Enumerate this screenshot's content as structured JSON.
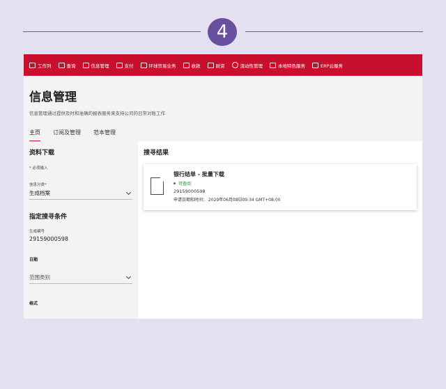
{
  "step": {
    "number": "4"
  },
  "nav": {
    "items": [
      {
        "icon": "briefcase-icon",
        "label": "工作列"
      },
      {
        "icon": "camera-icon",
        "label": "查询"
      },
      {
        "icon": "folder-icon",
        "label": "信息管理"
      },
      {
        "icon": "wallet-icon",
        "label": "支付"
      },
      {
        "icon": "globe-icon",
        "label": "环球贸易业务"
      },
      {
        "icon": "cash-icon",
        "label": "收款"
      },
      {
        "icon": "folder-icon",
        "label": "财资"
      },
      {
        "icon": "currency-icon",
        "label": "流动性管理"
      },
      {
        "icon": "bank-icon",
        "label": "本地特色服务"
      },
      {
        "icon": "document-icon",
        "label": "ERP云服务"
      }
    ]
  },
  "page": {
    "title": "信息管理",
    "subtitle": "信息管理通过提供及时和准确的报表服务来支持公司的日常对账工作"
  },
  "tabs": [
    {
      "label": "主页",
      "active": true
    },
    {
      "label": "订阅及管理",
      "active": false
    },
    {
      "label": "范本管理",
      "active": false
    }
  ],
  "left": {
    "download_title": "资料下载",
    "required_note": "* 必须输入",
    "category_label": "信息分类*",
    "category_value": "生成档案",
    "criteria_title": "指定搜寻条件",
    "ref_label": "生成编号",
    "ref_value": "29159000598",
    "date_title": "日期",
    "range_placeholder": "范围类别",
    "format_title": "格式"
  },
  "results": {
    "title": "搜寻结果",
    "card": {
      "title": "银行结单 - 批量下载",
      "status": "可查阅",
      "reference": "29159000598",
      "date": "申请日期和时间： 2029年06月08日09:34 GMT+08:00"
    }
  },
  "colors": {
    "brand_red": "#c8102e",
    "step_purple": "#6a4fa0",
    "status_green": "#1a8f3c",
    "backdrop": "#e3e1f1"
  }
}
